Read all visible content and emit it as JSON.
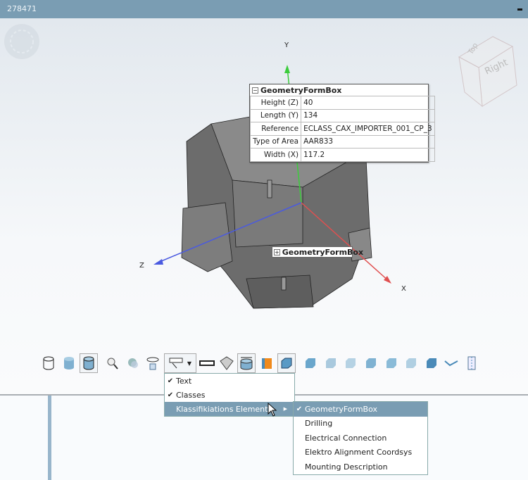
{
  "window": {
    "title": "278471"
  },
  "viewport": {
    "axes": {
      "y": "Y",
      "z": "Z",
      "x": "X"
    },
    "view_cube": {
      "top": "Top",
      "right": "Right"
    },
    "geometry_box": {
      "title": "GeometryFormBox",
      "rows": [
        {
          "key": "Height (Z)",
          "value": "40"
        },
        {
          "key": "Length (Y)",
          "value": "134"
        },
        {
          "key": "Reference",
          "value": "ECLASS_CAX_IMPORTER_001_CP_3"
        },
        {
          "key": "Type of Area",
          "value": "AAR833"
        },
        {
          "key": "Width (X)",
          "value": "117.2"
        }
      ]
    },
    "collapsed_box": {
      "title": "GeometryFormBox"
    }
  },
  "toolbar": {
    "icons": [
      "wireframe-cylinder-icon",
      "shaded-cylinder-icon",
      "shaded-edges-cylinder-icon",
      "zoom-fit-icon",
      "zoom-window-icon",
      "rotate-icon",
      "annotation-dropdown-icon",
      "measure-ruler-icon",
      "mesh-icon",
      "dimension-icon",
      "section-icon",
      "box-icon",
      "view-front-icon",
      "view-back-icon",
      "view-left-icon",
      "view-right-icon",
      "view-top-icon",
      "view-bottom-icon",
      "view-iso-icon",
      "check-icon",
      "clip-icon"
    ]
  },
  "menu": {
    "items": [
      {
        "label": "Text",
        "checked": true
      },
      {
        "label": "Classes",
        "checked": true
      },
      {
        "label": "Klassifikiations Elemente",
        "checked": false
      }
    ],
    "submenu": [
      {
        "label": "GeometryFormBox",
        "checked": true
      },
      {
        "label": "Drilling",
        "checked": false
      },
      {
        "label": "Electrical Connection",
        "checked": false
      },
      {
        "label": "Elektro Alignment Coordsys",
        "checked": false
      },
      {
        "label": "Mounting Description",
        "checked": false
      }
    ]
  },
  "colors": {
    "titlebar": "#7a9db3",
    "highlight": "#7a9db3",
    "x_axis": "#e05050",
    "y_axis": "#3ccc3c",
    "z_axis": "#4a5ae0"
  }
}
